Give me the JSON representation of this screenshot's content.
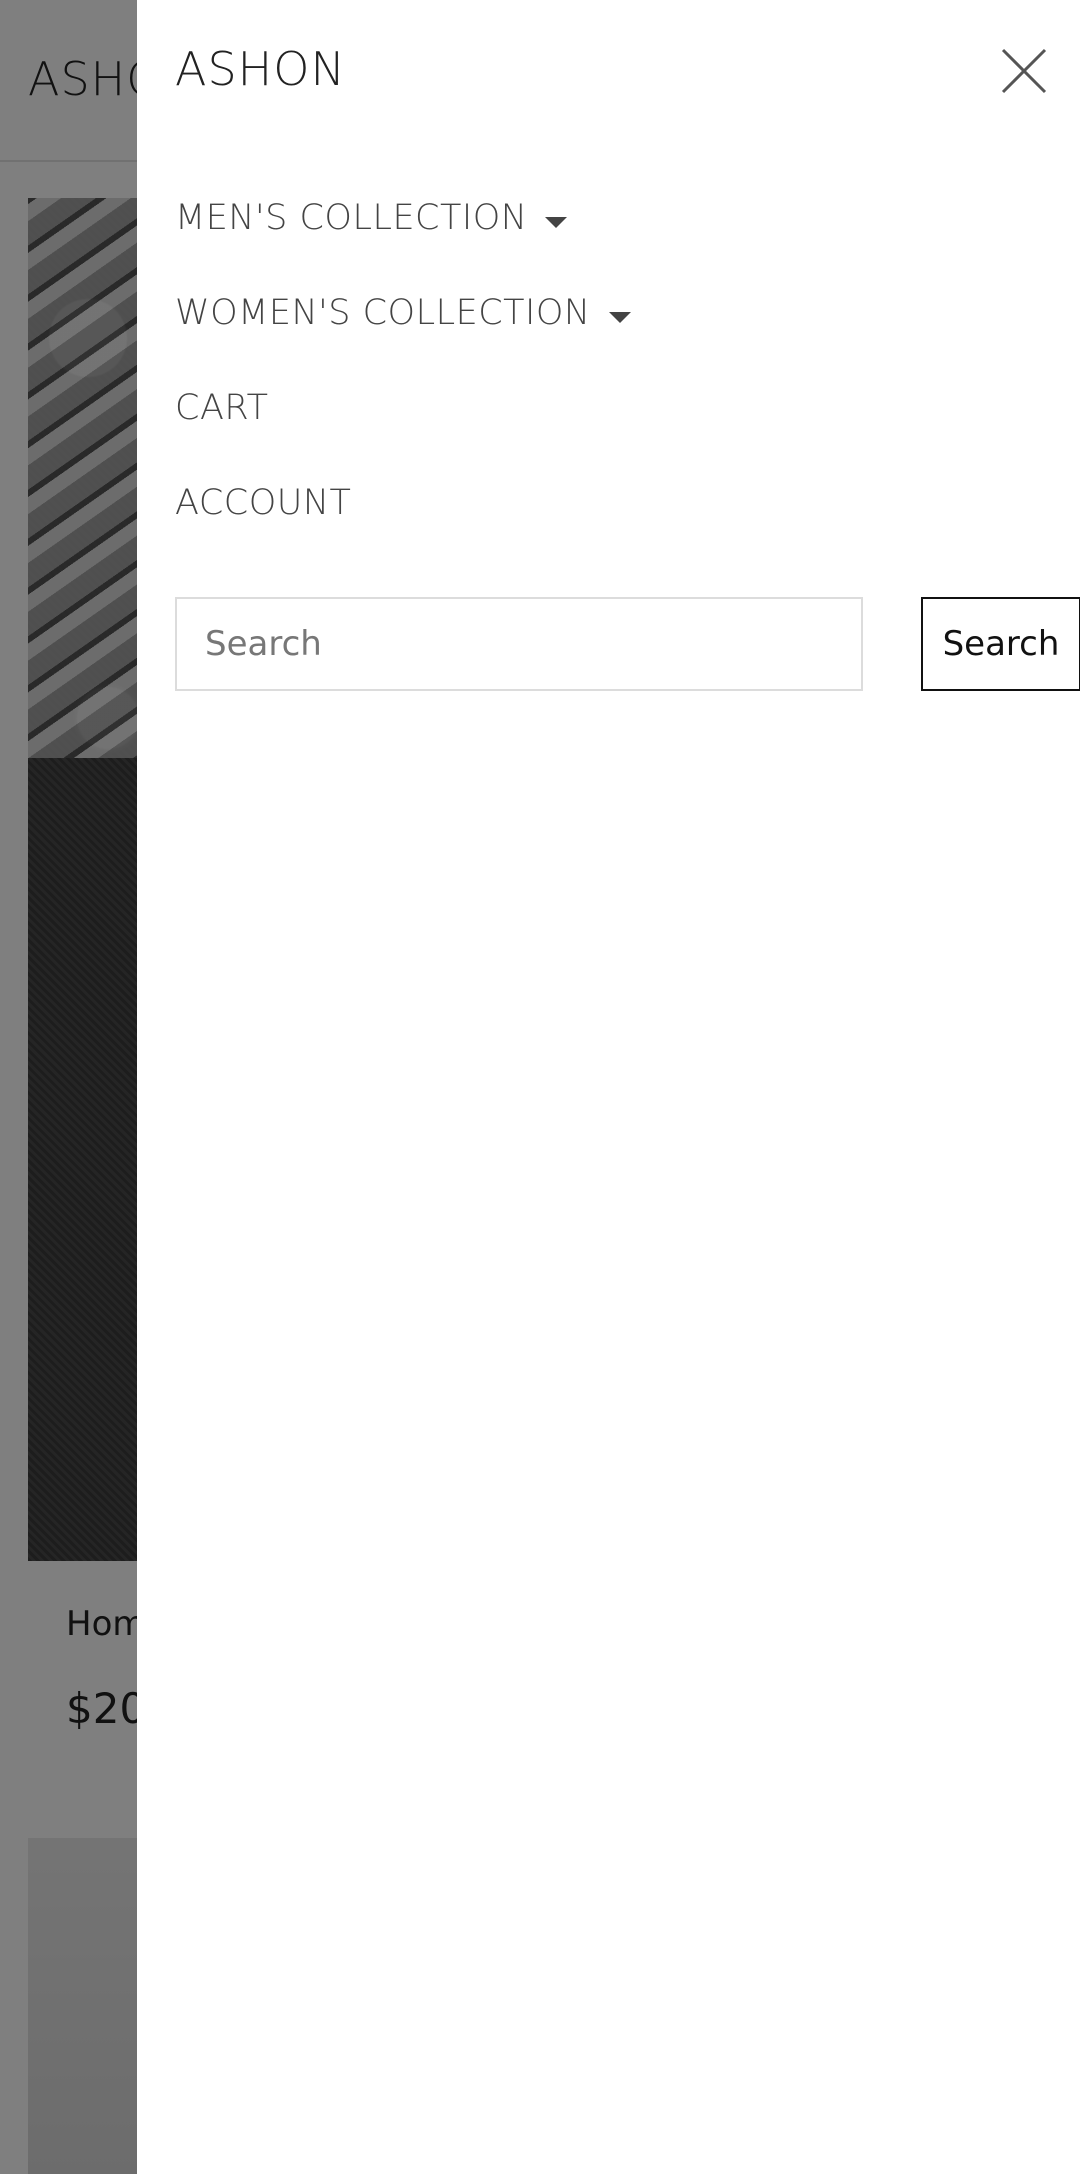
{
  "background": {
    "logo": "ASHON",
    "product_caption": "Hom",
    "product_price": "$20."
  },
  "drawer": {
    "logo": "ASHON",
    "close_icon": "close-icon",
    "nav": [
      {
        "label": "MEN'S COLLECTION",
        "has_dropdown": true
      },
      {
        "label": "WOMEN'S COLLECTION",
        "has_dropdown": true
      },
      {
        "label": "CART",
        "has_dropdown": false
      },
      {
        "label": "ACCOUNT",
        "has_dropdown": false
      }
    ],
    "search": {
      "placeholder": "Search",
      "value": "",
      "button_label": "Search"
    }
  }
}
